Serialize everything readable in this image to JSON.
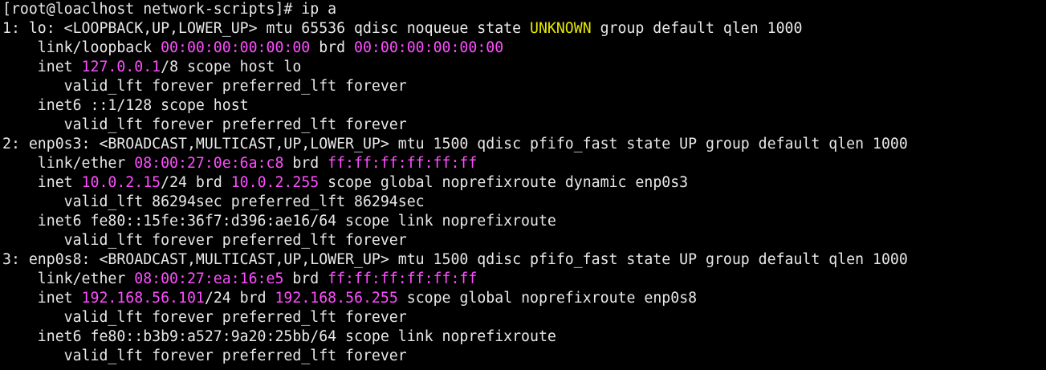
{
  "terminal": {
    "colors": {
      "background": "#000000",
      "text": "#e8e8e8",
      "address": "#ff4dff",
      "state_unknown": "#e6e600"
    },
    "lines": [
      [
        {
          "text": "[root@loaclhost network-scripts]# ip a",
          "color": "default"
        }
      ],
      [
        {
          "text": "1: lo: <LOOPBACK,UP,LOWER_UP> mtu 65536 qdisc noqueue state ",
          "color": "default"
        },
        {
          "text": "UNKNOWN",
          "color": "yellow"
        },
        {
          "text": " group default qlen 1000",
          "color": "default"
        }
      ],
      [
        {
          "text": "    link/loopback ",
          "color": "default"
        },
        {
          "text": "00:00:00:00:00:00",
          "color": "magenta"
        },
        {
          "text": " brd ",
          "color": "default"
        },
        {
          "text": "00:00:00:00:00:00",
          "color": "magenta"
        }
      ],
      [
        {
          "text": "    inet ",
          "color": "default"
        },
        {
          "text": "127.0.0.1",
          "color": "magenta"
        },
        {
          "text": "/8 scope host lo",
          "color": "default"
        }
      ],
      [
        {
          "text": "       valid_lft forever preferred_lft forever",
          "color": "default"
        }
      ],
      [
        {
          "text": "    inet6 ::1/128 scope host",
          "color": "default"
        }
      ],
      [
        {
          "text": "       valid_lft forever preferred_lft forever",
          "color": "default"
        }
      ],
      [
        {
          "text": "2: enp0s3: <BROADCAST,MULTICAST,UP,LOWER_UP> mtu 1500 qdisc pfifo_fast state UP group default qlen 1000",
          "color": "default"
        }
      ],
      [
        {
          "text": "    link/ether ",
          "color": "default"
        },
        {
          "text": "08:00:27:0e:6a:c8",
          "color": "magenta"
        },
        {
          "text": " brd ",
          "color": "default"
        },
        {
          "text": "ff:ff:ff:ff:ff:ff",
          "color": "magenta"
        }
      ],
      [
        {
          "text": "    inet ",
          "color": "default"
        },
        {
          "text": "10.0.2.15",
          "color": "magenta"
        },
        {
          "text": "/24 brd ",
          "color": "default"
        },
        {
          "text": "10.0.2.255",
          "color": "magenta"
        },
        {
          "text": " scope global noprefixroute dynamic enp0s3",
          "color": "default"
        }
      ],
      [
        {
          "text": "       valid_lft 86294sec preferred_lft 86294sec",
          "color": "default"
        }
      ],
      [
        {
          "text": "    inet6 fe80::15fe:36f7:d396:ae16/64 scope link noprefixroute",
          "color": "default"
        }
      ],
      [
        {
          "text": "       valid_lft forever preferred_lft forever",
          "color": "default"
        }
      ],
      [
        {
          "text": "3: enp0s8: <BROADCAST,MULTICAST,UP,LOWER_UP> mtu 1500 qdisc pfifo_fast state UP group default qlen 1000",
          "color": "default"
        }
      ],
      [
        {
          "text": "    link/ether ",
          "color": "default"
        },
        {
          "text": "08:00:27:ea:16:e5",
          "color": "magenta"
        },
        {
          "text": " brd ",
          "color": "default"
        },
        {
          "text": "ff:ff:ff:ff:ff:ff",
          "color": "magenta"
        }
      ],
      [
        {
          "text": "    inet ",
          "color": "default"
        },
        {
          "text": "192.168.56.101",
          "color": "magenta"
        },
        {
          "text": "/24 brd ",
          "color": "default"
        },
        {
          "text": "192.168.56.255",
          "color": "magenta"
        },
        {
          "text": " scope global noprefixroute enp0s8",
          "color": "default"
        }
      ],
      [
        {
          "text": "       valid_lft forever preferred_lft forever",
          "color": "default"
        }
      ],
      [
        {
          "text": "    inet6 fe80::b3b9:a527:9a20:25bb/64 scope link noprefixroute",
          "color": "default"
        }
      ],
      [
        {
          "text": "       valid_lft forever preferred_lft forever",
          "color": "default"
        }
      ]
    ]
  }
}
